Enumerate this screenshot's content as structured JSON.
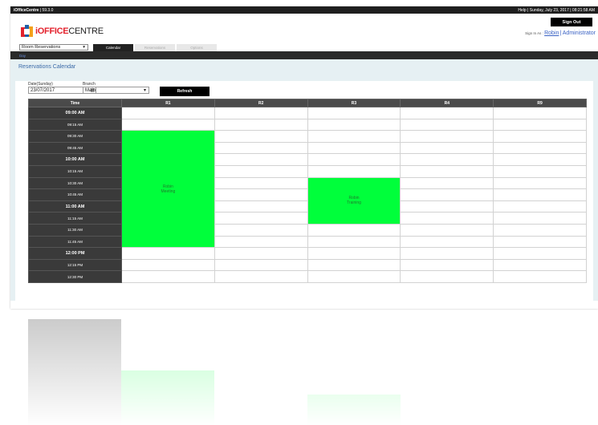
{
  "topbar": {
    "app_name": "iOfficeCentre",
    "version": "| 59.3.0",
    "right_text": "Help | Sunday, July 23, 2017 | 08:21:58 AM"
  },
  "logo": {
    "part1": "i",
    "part2": "OFFICE",
    "part3": "CENTRE"
  },
  "header": {
    "signout_label": "Sign Out",
    "signin_prefix": "Sign In As :",
    "user": "Robin",
    "separator": "|",
    "role": "Administrator"
  },
  "menu": {
    "module_select": "Room Reservations",
    "tabs": [
      {
        "label": "Calendar",
        "active": true
      },
      {
        "label": "Reservations",
        "active": false
      },
      {
        "label": "Options",
        "active": false
      }
    ]
  },
  "subnav": {
    "day_label": "Day"
  },
  "page": {
    "title": "Reservations Calendar"
  },
  "filters": {
    "date_label": "Date(Sunday)",
    "date_value": "23/07/2017",
    "branch_label": "Branch",
    "branch_value": "Main",
    "refresh_label": "Refresh"
  },
  "calendar": {
    "time_header": "Time",
    "rooms": [
      "R1",
      "R2",
      "R3",
      "R4",
      "R9"
    ],
    "slots": [
      "09:00 AM",
      "09:15 AM",
      "09:30 AM",
      "09:45 AM",
      "10:00 AM",
      "10:15 AM",
      "10:30 AM",
      "10:45 AM",
      "11:00 AM",
      "11:15 AM",
      "11:30 AM",
      "11:45 AM",
      "12:00 PM",
      "12:15 PM",
      "12:30 PM"
    ],
    "events": [
      {
        "room": "R1",
        "line1": "Robin",
        "line2": "Meeting",
        "start": "09:30 AM",
        "end": "11:45 AM"
      },
      {
        "room": "R3",
        "line1": "Robin",
        "line2": "Training",
        "start": "10:30 AM",
        "end": "11:15 AM"
      }
    ]
  },
  "colors": {
    "event_green": "#00ff3b",
    "time_column": "#3a3a3a",
    "header_dark": "#1f1f1f",
    "link_blue": "#3a62c4",
    "logo_red": "#e3222d",
    "logo_orange": "#f4a11b"
  }
}
